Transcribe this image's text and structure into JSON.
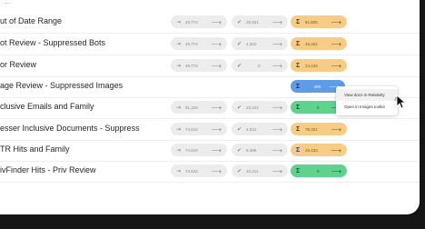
{
  "truncated_header": "...",
  "rows": [
    {
      "name": "ut of Date Range",
      "v1": "49,774",
      "v2": "25,501",
      "v3": "81,805",
      "v3_color": "orange"
    },
    {
      "name": "ot Review - Suppressed Bots",
      "v1": "49,774",
      "v2": "4,322",
      "v3": "45,322",
      "v3_color": "orange"
    },
    {
      "name": "or Review",
      "v1": "49,774",
      "v2": "0",
      "v3": "24,433",
      "v3_color": "orange"
    },
    {
      "name": "age Review - Suppressed Images",
      "v1": "",
      "v2": "",
      "v3": "489",
      "v3_color": "blue"
    },
    {
      "name": "clusive Emails and Family",
      "v1": "81,333",
      "v2": "23,222",
      "v3": "0",
      "v3_color": "green"
    },
    {
      "name": "esser Inclusive Documents - Suppress",
      "v1": "74,633",
      "v2": "4,531",
      "v3": "78,321",
      "v3_color": "orange"
    },
    {
      "name": "TR Hits and Family",
      "v1": "74,633",
      "v2": "8,399",
      "v3": "29,433",
      "v3_color": "orange"
    },
    {
      "name": "ivFinder Hits - Priv Review",
      "v1": "74,633",
      "v2": "10,211",
      "v3": "0",
      "v3_color": "green"
    }
  ],
  "context_menu": {
    "items": [
      "View docs in Relativity",
      "Open in Images toolkit"
    ]
  },
  "icons": {
    "in": "login-arrow-icon",
    "check": "checkmark-icon",
    "sigma": "sigma-icon",
    "arrow": "right-arrow-icon",
    "cursor": "mouse-pointer-icon"
  },
  "colors": {
    "orange": "#f7cc86",
    "green": "#5fd28e",
    "blue": "#5d9ce6",
    "neutral": "#ececec"
  }
}
